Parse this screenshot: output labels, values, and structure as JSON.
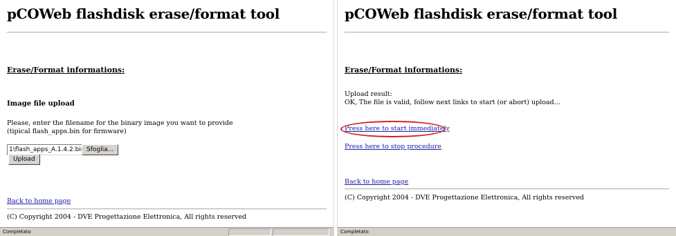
{
  "left": {
    "title": "pCOWeb flashdisk erase/format tool",
    "section_title": "Erase/Format informations:",
    "subheading": "Image file upload",
    "instructions_line1": "Please, enter the filename for the binary image you want to provide",
    "instructions_line2": "(tipical flash_apps.bin for firmware)",
    "file_value": "1\\flash_apps_A.1.4.2.bin",
    "browse_label": "Sfoglia...",
    "upload_label": "Upload",
    "back_link": "Back to home page",
    "copyright": "(C) Copyright 2004 - DVE Progettazione Elettronica, All rights reserved",
    "status": "Completato"
  },
  "right": {
    "title": "pCOWeb flashdisk erase/format tool",
    "section_title": "Erase/Format informations:",
    "result_label": "Upload result:",
    "result_text": "OK, The file is valid, follow next links to start (or abort) upload...",
    "start_link": "Press here to start immediately",
    "stop_link": "Press here to stop procedure",
    "back_link": "Back to home page",
    "copyright": "(C) Copyright 2004 - DVE Progettazione Elettronica, All rights reserved",
    "status": "Completato"
  },
  "colors": {
    "link": "#1a1aa6",
    "highlight": "#d42020",
    "statusbar": "#d4d0c8"
  }
}
